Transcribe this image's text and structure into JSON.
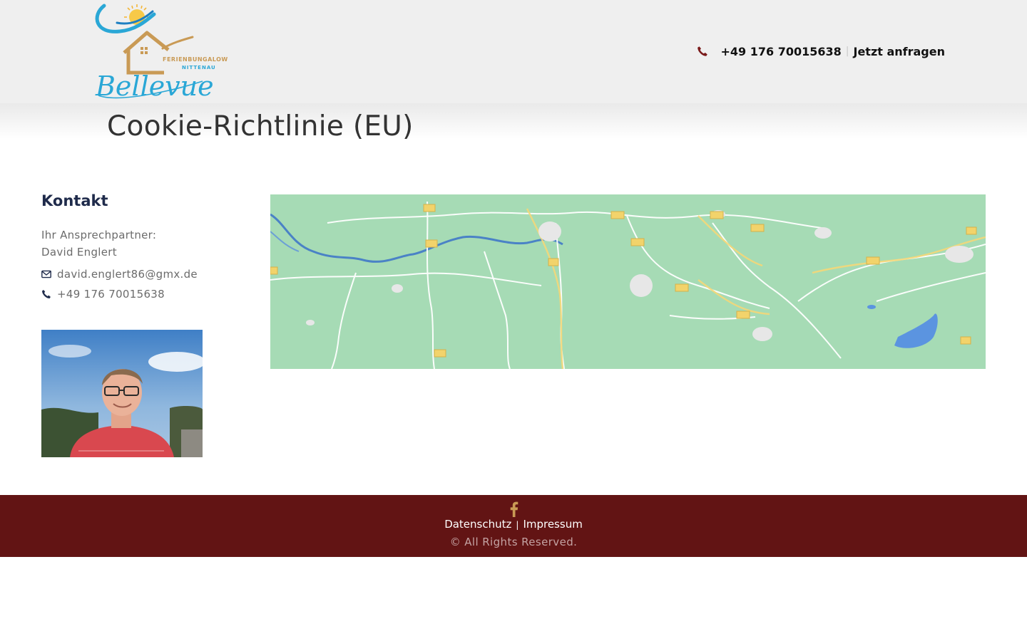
{
  "header": {
    "logo": {
      "script_text": "Bellevue",
      "tag_top": "FERIENBUNGALOW",
      "tag_bottom": "NITTENAU"
    },
    "phone": "+49 176 70015638",
    "separator": "|",
    "cta": "Jetzt anfragen"
  },
  "main": {
    "title": "Cookie-Richtlinie (EU)"
  },
  "sidebar": {
    "heading": "Kontakt",
    "contact_label": "Ihr Ansprechpartner:",
    "contact_name": "David Englert",
    "email": "david.englert86@gmx.de",
    "phone": "+49 176 70015638"
  },
  "footer": {
    "links": [
      "Datenschutz",
      "Impressum"
    ],
    "separator": "|",
    "copyright": "© All Rights Reserved."
  },
  "colors": {
    "header_bg": "#efefef",
    "footer_bg": "#621414",
    "accent_red": "#7a1a1a",
    "heading_navy": "#1f2b4b",
    "logo_blue": "#2aa7d6",
    "logo_gold": "#c99a55",
    "map_green": "#a6dbb5"
  },
  "icons": {
    "phone": "phone-icon",
    "email": "envelope-icon",
    "social": "facebook-icon"
  }
}
